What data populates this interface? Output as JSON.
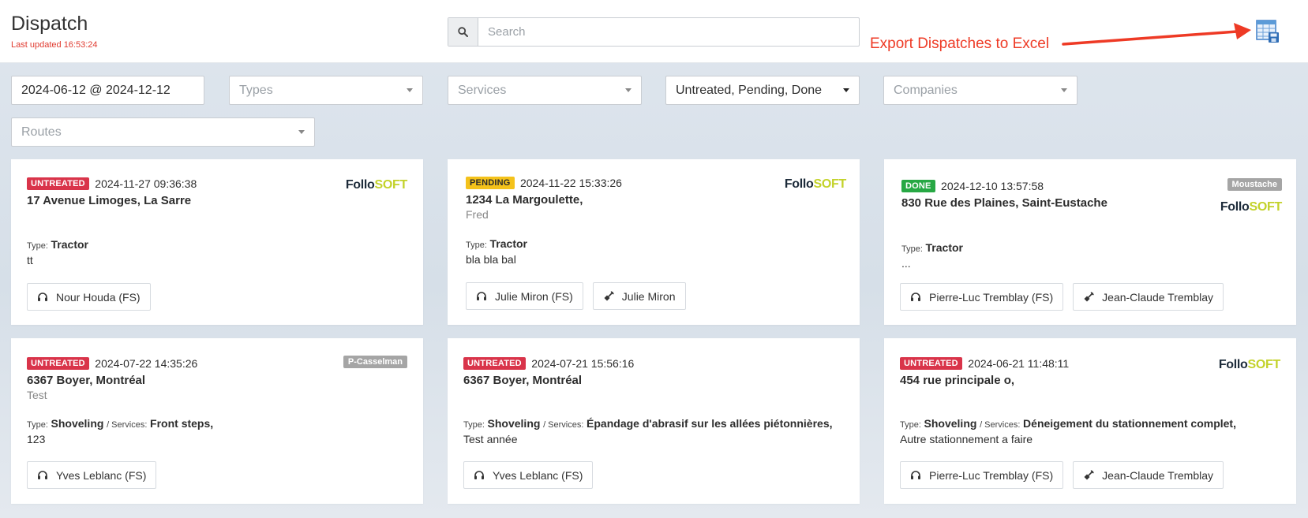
{
  "header": {
    "title": "Dispatch",
    "last_updated_label": "Last updated",
    "last_updated_time": "16:53:24",
    "search_placeholder": "Search",
    "annotation": "Export Dispatches to Excel"
  },
  "filters": {
    "date_range": "2024-06-12 @ 2024-12-12",
    "types": "Types",
    "services": "Services",
    "statuses": "Untreated, Pending, Done",
    "companies": "Companies",
    "routes": "Routes"
  },
  "logo": {
    "part1": "Follo",
    "part2": "SOFT"
  },
  "cards": [
    {
      "status": "UNTREATED",
      "datetime": "2024-11-27 09:36:38",
      "address": "17 Avenue Limoges, La Sarre",
      "type_label": "Type:",
      "type": "Tractor",
      "note": "tt",
      "agent": "Nour Houda (FS)"
    },
    {
      "status": "PENDING",
      "datetime": "2024-11-22 15:33:26",
      "address": "1234 La Margoulette,",
      "subaddress": "Fred",
      "type_label": "Type:",
      "type": "Tractor",
      "note": "bla bla bal",
      "agent": "Julie Miron (FS)",
      "operator": "Julie Miron"
    },
    {
      "status": "DONE",
      "datetime": "2024-12-10 13:57:58",
      "address": "830 Rue des Plaines, Saint-Eustache",
      "company_tag": "Moustache",
      "type_label": "Type:",
      "type": "Tractor",
      "note": "...",
      "agent": "Pierre-Luc Tremblay (FS)",
      "operator": "Jean-Claude Tremblay"
    },
    {
      "status": "UNTREATED",
      "datetime": "2024-07-22 14:35:26",
      "address": "6367 Boyer, Montréal",
      "subaddress": "Test",
      "company_tag": "P-Casselman",
      "type_label": "Type:",
      "type": "Shoveling",
      "services_label": "/ Services:",
      "services": "Front steps,",
      "note": "123",
      "agent": "Yves Leblanc (FS)"
    },
    {
      "status": "UNTREATED",
      "datetime": "2024-07-21 15:56:16",
      "address": "6367 Boyer, Montréal",
      "type_label": "Type:",
      "type": "Shoveling",
      "services_label": "/ Services:",
      "services": "Épandage d'abrasif sur les allées piétonnières,",
      "note": "Test année",
      "agent": "Yves Leblanc (FS)"
    },
    {
      "status": "UNTREATED",
      "datetime": "2024-06-21 11:48:11",
      "address": "454 rue principale o,",
      "type_label": "Type:",
      "type": "Shoveling",
      "services_label": "/ Services:",
      "services": "Déneigement du stationnement complet,",
      "note": "Autre stationnement a faire",
      "agent": "Pierre-Luc Tremblay (FS)",
      "operator": "Jean-Claude Tremblay"
    }
  ],
  "icons": {
    "search": "search-icon",
    "export": "excel-export-icon",
    "agent": "headset-icon",
    "operator": "shovel-icon",
    "dropdown": "caret-down-icon"
  },
  "colors": {
    "untreated": "#d9344a",
    "pending": "#f4c21b",
    "done": "#27a844",
    "annotation": "#ee3a25",
    "logo_dark": "#1d2b3a",
    "logo_accent": "#c3d22a",
    "tag": "#a5a5a5"
  }
}
